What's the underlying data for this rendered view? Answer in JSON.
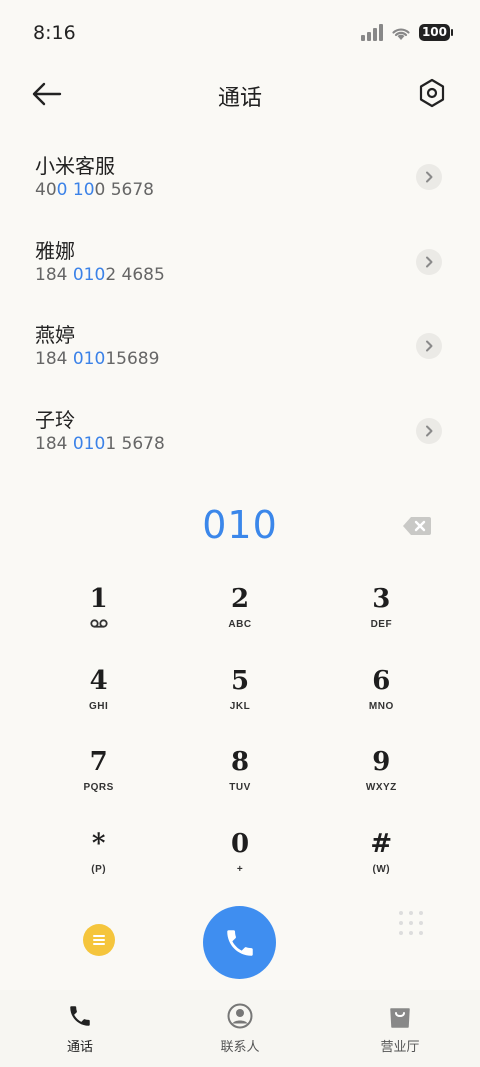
{
  "status_bar": {
    "time": "8:16",
    "battery": "100"
  },
  "header": {
    "title": "通话",
    "back_icon": "arrow-left-icon",
    "settings_icon": "hexagon-settings-icon"
  },
  "contacts": [
    {
      "name": "小米客服",
      "number_parts": [
        "40",
        "0",
        " ",
        "10",
        "0 5678"
      ],
      "highlight": [
        false,
        true,
        false,
        true,
        false
      ]
    },
    {
      "name": "雅娜",
      "number_parts": [
        "184 ",
        "010",
        "2 4685"
      ],
      "highlight": [
        false,
        true,
        false
      ]
    },
    {
      "name": "燕婷",
      "number_parts": [
        "184 ",
        "010",
        "15689"
      ],
      "highlight": [
        false,
        true,
        false
      ]
    },
    {
      "name": "子玲",
      "number_parts": [
        "184 ",
        "010",
        "1 5678"
      ],
      "highlight": [
        false,
        true,
        false
      ]
    }
  ],
  "dialed_number": "010",
  "keypad": [
    [
      {
        "digit": "1",
        "letters": "voicemail-icon"
      },
      {
        "digit": "2",
        "letters": "ABC"
      },
      {
        "digit": "3",
        "letters": "DEF"
      }
    ],
    [
      {
        "digit": "4",
        "letters": "GHI"
      },
      {
        "digit": "5",
        "letters": "JKL"
      },
      {
        "digit": "6",
        "letters": "MNO"
      }
    ],
    [
      {
        "digit": "7",
        "letters": "PQRS"
      },
      {
        "digit": "8",
        "letters": "TUV"
      },
      {
        "digit": "9",
        "letters": "WXYZ"
      }
    ],
    [
      {
        "digit": "*",
        "letters": "(P)"
      },
      {
        "digit": "0",
        "letters": "+"
      },
      {
        "digit": "#",
        "letters": "(W)"
      }
    ]
  ],
  "bottom_nav": [
    {
      "label": "通话",
      "icon": "phone-icon",
      "active": true
    },
    {
      "label": "联系人",
      "icon": "person-icon",
      "active": false
    },
    {
      "label": "营业厅",
      "icon": "shopping-bag-icon",
      "active": false
    }
  ],
  "colors": {
    "accent": "#3f8ef0",
    "highlight": "#3b82e8",
    "menu": "#f5c53c",
    "background": "#faf9f5"
  }
}
